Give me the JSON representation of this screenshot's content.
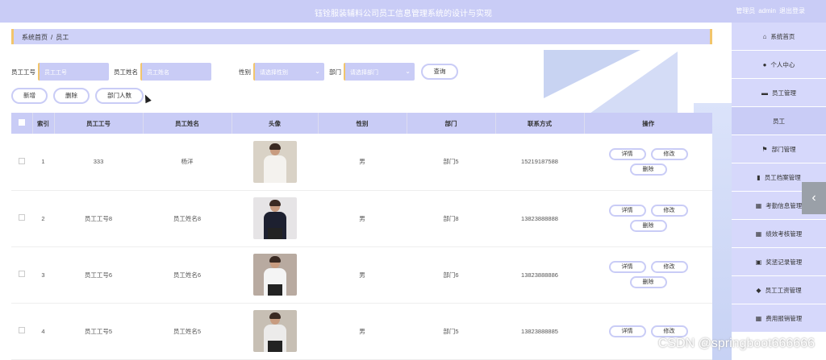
{
  "header": {
    "title": "钰铨服装辅料公司员工信息管理系统的设计与实现",
    "role_label": "管理员",
    "username": "admin",
    "logout": "退出登录"
  },
  "breadcrumb": {
    "home": "系统首页",
    "separator": "/",
    "current": "员工"
  },
  "search": {
    "employee_no_label": "员工工号",
    "employee_no_placeholder": "员工工号",
    "employee_name_label": "员工姓名",
    "employee_name_placeholder": "员工姓名",
    "gender_label": "性别",
    "gender_placeholder": "请选择性别",
    "dept_label": "部门",
    "dept_placeholder": "请选择部门",
    "query_button": "查询"
  },
  "actions": {
    "add": "新增",
    "delete": "删除",
    "dept_count": "部门人数"
  },
  "table": {
    "headers": [
      "索引",
      "员工工号",
      "员工姓名",
      "头像",
      "性别",
      "部门",
      "联系方式",
      "操作"
    ],
    "op_labels": {
      "detail": "详情",
      "edit": "修改",
      "delete": "删除"
    },
    "rows": [
      {
        "index": "1",
        "emp_no": "333",
        "name": "杨洋",
        "gender": "男",
        "dept": "部门5",
        "phone": "15219187588"
      },
      {
        "index": "2",
        "emp_no": "员工工号8",
        "name": "员工姓名8",
        "gender": "男",
        "dept": "部门8",
        "phone": "13823888888"
      },
      {
        "index": "3",
        "emp_no": "员工工号6",
        "name": "员工姓名6",
        "gender": "男",
        "dept": "部门6",
        "phone": "13823888886"
      },
      {
        "index": "4",
        "emp_no": "员工工号5",
        "name": "员工姓名5",
        "gender": "男",
        "dept": "部门5",
        "phone": "13823888885"
      }
    ]
  },
  "sidebar": {
    "items": [
      {
        "label": "系统首页",
        "icon": "home-icon"
      },
      {
        "label": "个人中心",
        "icon": "user-icon"
      },
      {
        "label": "员工管理",
        "icon": "list-icon"
      },
      {
        "label": "员工",
        "icon": ""
      },
      {
        "label": "部门管理",
        "icon": "flag-icon"
      },
      {
        "label": "员工档案管理",
        "icon": "bar-chart-icon"
      },
      {
        "label": "考勤信息管理",
        "icon": "grid-icon"
      },
      {
        "label": "绩效考核管理",
        "icon": "grid-icon"
      },
      {
        "label": "奖惩记录管理",
        "icon": "clipboard-icon"
      },
      {
        "label": "员工工资管理",
        "icon": "pin-icon"
      },
      {
        "label": "费用报销管理",
        "icon": "grid-icon"
      }
    ]
  },
  "watermark": "CSDN @springboot666666"
}
